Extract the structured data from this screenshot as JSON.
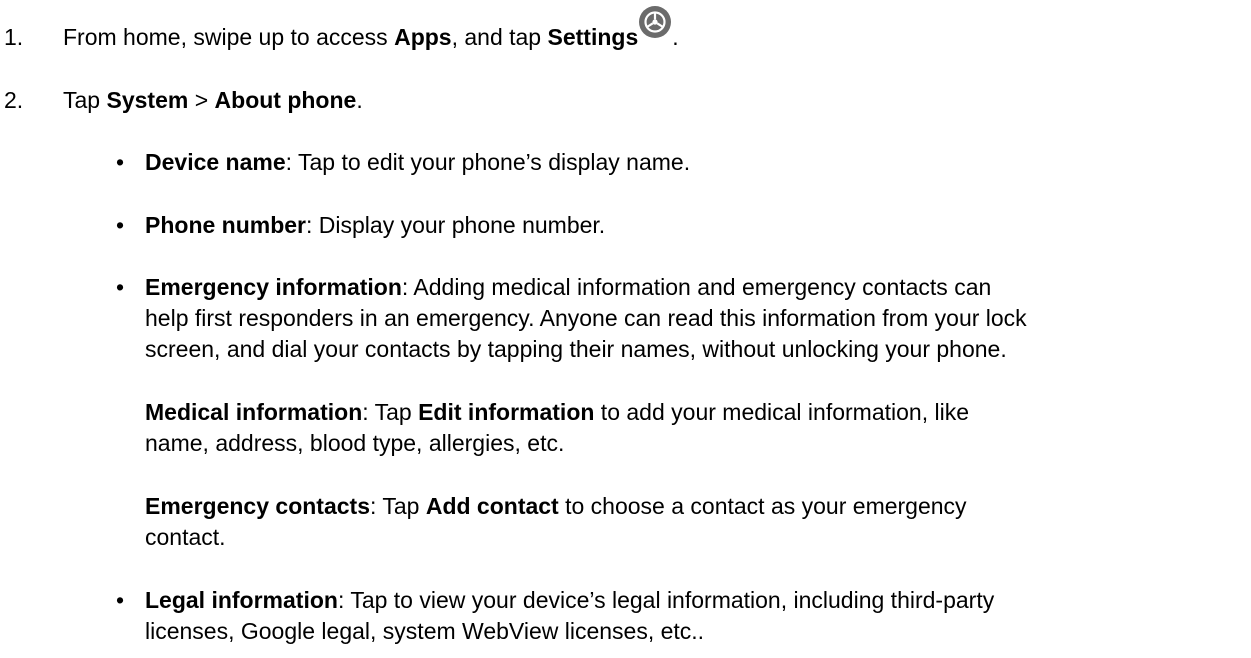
{
  "steps": [
    {
      "number": "1.",
      "parts": [
        {
          "text": "From home, swipe up to access ",
          "bold": false
        },
        {
          "text": "Apps",
          "bold": true
        },
        {
          "text": ", and tap ",
          "bold": false
        },
        {
          "text": "Settings",
          "bold": true
        },
        {
          "text": ".",
          "bold": false
        }
      ],
      "icon": "settings-gear-icon"
    },
    {
      "number": "2.",
      "parts": [
        {
          "text": "Tap ",
          "bold": false
        },
        {
          "text": "System",
          "bold": true
        },
        {
          "text": " > ",
          "bold": false
        },
        {
          "text": "About phone",
          "bold": true
        },
        {
          "text": ".",
          "bold": false
        }
      ]
    }
  ],
  "bullets": [
    {
      "label": "Device name",
      "lines": [
        ": Tap to edit your phone’s display name."
      ]
    },
    {
      "label": "Phone number",
      "lines": [
        ": Display your phone number."
      ]
    },
    {
      "label": "Emergency information",
      "lines": [
        ": Adding medical information and emergency contacts can",
        "help first responders in an emergency. Anyone can read this information from your lock",
        "screen, and dial your contacts by tapping their names, without unlocking your phone."
      ]
    },
    {
      "label": "Legal information",
      "lines": [
        ": Tap to view your device’s legal information, including third-party",
        "licenses, Google legal, system WebView licenses, etc.."
      ]
    }
  ],
  "sub_paragraphs": [
    {
      "label": "Medical information",
      "mid_text": ": Tap ",
      "mid_bold": "Edit information",
      "lines": [
        " to add your medical information, like",
        "name, address, blood type, allergies, etc."
      ]
    },
    {
      "label": "Emergency contacts",
      "mid_text": ": Tap ",
      "mid_bold": "Add contact",
      "lines": [
        " to choose a contact as your emergency",
        "contact."
      ]
    }
  ],
  "bullet_char": "•",
  "colors": {
    "text": "#000000",
    "icon_fill": "#6b6b6b",
    "icon_stroke": "#ffffff"
  }
}
